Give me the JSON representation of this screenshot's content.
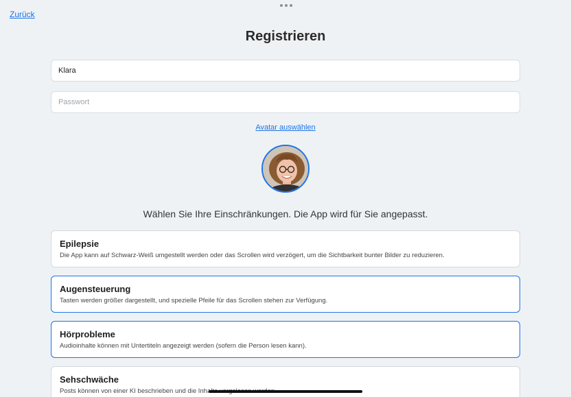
{
  "nav": {
    "back_label": "Zurück"
  },
  "header": {
    "title": "Registrieren"
  },
  "form": {
    "name_value": "Klara",
    "name_placeholder": "",
    "password_value": "",
    "password_placeholder": "Passwort"
  },
  "avatar": {
    "link_label": "Avatar auswählen"
  },
  "intro_text": "Wählen Sie Ihre Einschränkungen. Die App wird für Sie angepasst.",
  "options": [
    {
      "title": "Epilepsie",
      "description": "Die App kann auf Schwarz-Weiß umgestellt werden oder das Scrollen wird verzögert, um die Sichtbarkeit bunter Bilder zu reduzieren.",
      "selected": false
    },
    {
      "title": "Augensteuerung",
      "description": "Tasten werden größer dargestellt, und spezielle Pfeile für das Scrollen stehen zur Verfügung.",
      "selected": true
    },
    {
      "title": "Hörprobleme",
      "description": "Audioinhalte können mit Untertiteln angezeigt werden (sofern die Person lesen kann).",
      "selected": true
    },
    {
      "title": "Sehschwäche",
      "description": "Posts können von einer KI beschrieben und die Inhalte vorgelesen werden.",
      "selected": false
    }
  ],
  "colors": {
    "accent": "#1a73e8",
    "background": "#eff2f5"
  }
}
